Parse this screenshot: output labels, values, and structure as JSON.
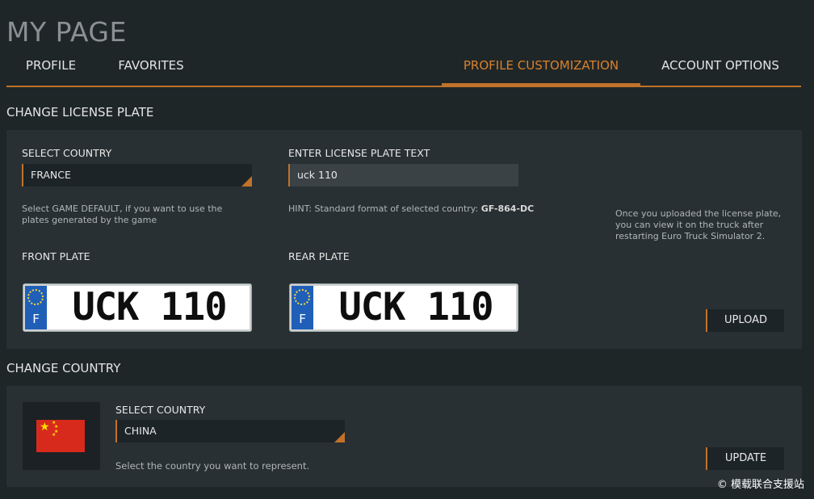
{
  "page": {
    "title": "MY PAGE"
  },
  "tabs": [
    {
      "label": "PROFILE"
    },
    {
      "label": "FAVORITES"
    },
    {
      "label": "PROFILE CUSTOMIZATION",
      "active": true
    },
    {
      "label": "ACCOUNT OPTIONS"
    }
  ],
  "license_section": {
    "title": "CHANGE LICENSE PLATE",
    "select_country_label": "SELECT COUNTRY",
    "selected_country": "FRANCE",
    "country_hint": "Select GAME DEFAULT, if you want to use the plates generated by the game",
    "plate_text_label": "ENTER LICENSE PLATE TEXT",
    "plate_text_value": "uck 110",
    "format_hint_prefix": "HINT: Standard format of selected country: ",
    "format_hint_example": "GF-864-DC",
    "upload_info": "Once you uploaded the license plate, you can view it on the truck after restarting Euro Truck Simulator 2.",
    "front_plate_label": "FRONT PLATE",
    "rear_plate_label": "REAR PLATE",
    "front_plate": {
      "country_letter": "F",
      "text": "UCK 110"
    },
    "rear_plate": {
      "country_letter": "F",
      "text": "UCK 110"
    },
    "upload_label": "UPLOAD"
  },
  "country_section": {
    "title": "CHANGE COUNTRY",
    "select_country_label": "SELECT COUNTRY",
    "selected_country": "CHINA",
    "hint": "Select the country you want to represent.",
    "update_label": "UPDATE",
    "flag_icon": "china-flag-icon"
  },
  "watermark": "© 模载联合支援站",
  "colors": {
    "accent": "#c0722a",
    "background": "#1f2628",
    "panel": "#283033",
    "plate_eu_blue": "#1f5fb8",
    "flag_red": "#d72a1d",
    "flag_yellow": "#ffde00"
  }
}
